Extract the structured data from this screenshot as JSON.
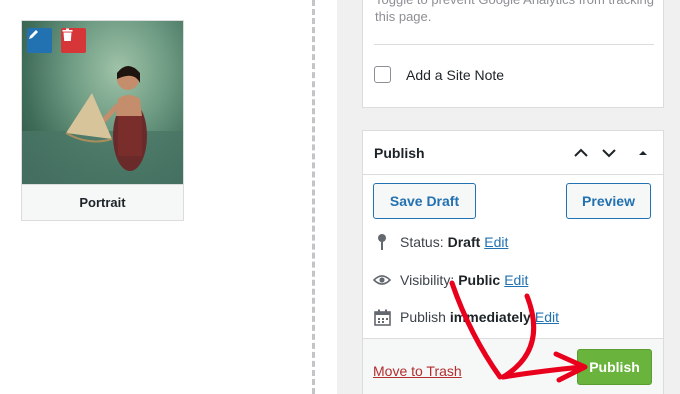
{
  "media": {
    "caption": "Portrait",
    "edit_icon": "pencil-icon",
    "delete_icon": "trash-icon",
    "edit_color": "#2271b1",
    "delete_color": "#d63638"
  },
  "tracking_panel": {
    "cut_text": "Toggle to prevent Google Analytics from tracking this page.",
    "site_note_label": "Add a Site Note"
  },
  "publish_panel": {
    "title": "Publish",
    "controls": [
      "chevron-up-icon",
      "chevron-down-icon",
      "triangle-up-icon"
    ],
    "save_draft_label": "Save Draft",
    "preview_label": "Preview",
    "status": {
      "label": "Status:",
      "value": "Draft",
      "edit": "Edit"
    },
    "visibility": {
      "label": "Visibility:",
      "value": "Public",
      "edit": "Edit"
    },
    "schedule": {
      "label": "Publish",
      "value": "immediately",
      "edit": "Edit"
    },
    "trash_label": "Move to Trash",
    "publish_label": "Publish",
    "publish_color": "#6ab43e"
  },
  "annotation": {
    "color": "#e8001c",
    "icon": "red-arrow-annotation"
  }
}
